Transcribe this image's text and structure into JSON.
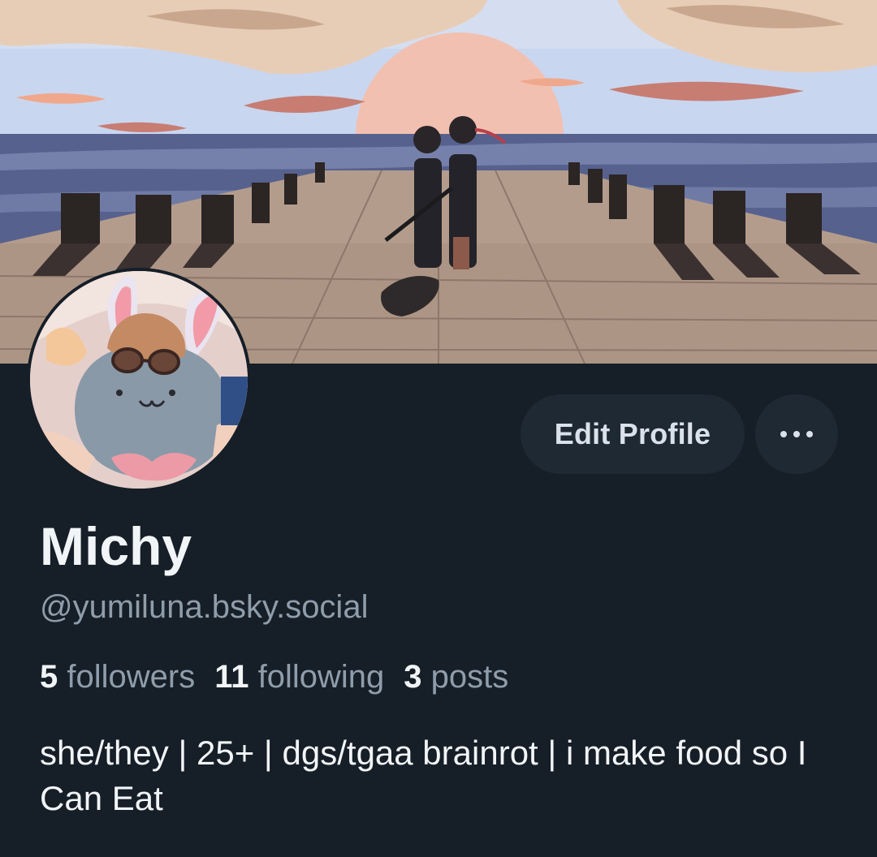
{
  "profile": {
    "display_name": "Michy",
    "handle": "@yumiluna.bsky.social",
    "bio": "she/they | 25+ | dgs/tgaa brainrot | i make food so I Can Eat"
  },
  "stats": {
    "followers_count": "5",
    "followers_label": "followers",
    "following_count": "11",
    "following_label": "following",
    "posts_count": "3",
    "posts_label": "posts"
  },
  "actions": {
    "edit_label": "Edit Profile",
    "more_icon": "ellipsis-icon"
  },
  "theme": {
    "background": "#161e27",
    "button_bg": "#1e2934",
    "text_primary": "#f2f5f8",
    "text_secondary": "#8f9dab"
  }
}
